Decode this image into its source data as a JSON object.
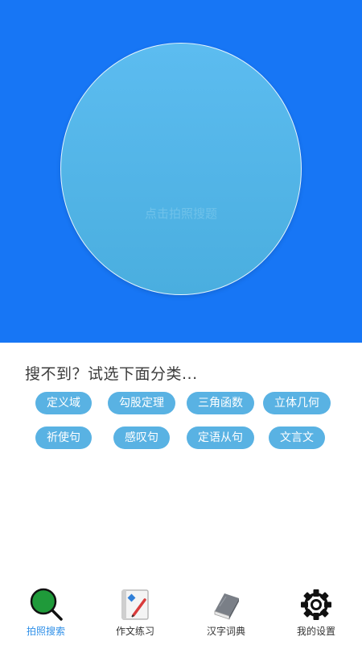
{
  "hero": {
    "camera_hint": "点击拍照搜题"
  },
  "suggest": {
    "title": "搜不到？试选下面分类..."
  },
  "categories": [
    "定义域",
    "勾股定理",
    "三角函数",
    "立体几何",
    "祈使句",
    "感叹句",
    "定语从句",
    "文言文"
  ],
  "tabbar": {
    "tabs": [
      {
        "label": "拍照搜索",
        "icon": "magnifier-icon",
        "active": true
      },
      {
        "label": "作文练习",
        "icon": "notebook-pen-icon",
        "active": false
      },
      {
        "label": "汉字词典",
        "icon": "book-icon",
        "active": false
      },
      {
        "label": "我的设置",
        "icon": "gear-icon",
        "active": false
      }
    ]
  },
  "colors": {
    "hero_bg": "#1776f5",
    "circle": "#5cbcf0",
    "chip_bg": "#59b2e3",
    "active_tab": "#2e8fe8"
  }
}
